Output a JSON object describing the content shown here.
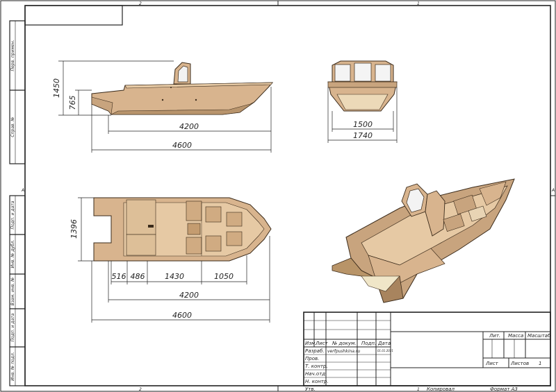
{
  "sheet": {
    "zones": {
      "top_left": "2",
      "top_right": "1",
      "bottom_left": "2",
      "bottom_right": "1",
      "left_mid": "A",
      "right_mid": "A"
    },
    "side_labels": [
      "Перв. примен.",
      "Справ. №",
      "Подп. и дата",
      "Инв. № дубл.",
      "Взам. инв. №",
      "Подп. и дата",
      "Инв. № подл."
    ],
    "footer": {
      "copied": "Копировал",
      "format": "Формат А3"
    }
  },
  "dimensions": {
    "side_height": "1450",
    "side_draft": "765",
    "side_hull_length": "4200",
    "side_total_length": "4600",
    "front_inner_width": "1500",
    "front_outer_width": "1740",
    "plan_width": "1396",
    "plan_seg1": "516",
    "plan_seg2": "486",
    "plan_seg3": "1430",
    "plan_seg4": "1050",
    "plan_hull_length": "4200",
    "plan_total_length": "4600"
  },
  "title_block": {
    "cols": [
      "Изм.",
      "Лист",
      "№ докум.",
      "Подп.",
      "Дата"
    ],
    "rows": [
      "Разраб.",
      "Пров.",
      "Т. контр.",
      "Нач.отд.",
      "Н. контр.",
      "Утв."
    ],
    "developer": "verfpushkina.ru",
    "date": "01.01.2021",
    "lit": "Лит.",
    "mass": "Масса",
    "scale": "Масштаб",
    "sheet": "Лист",
    "sheets": "Листов",
    "sheets_count": "1"
  },
  "colors": {
    "hull": "#d8b48e",
    "hull_dark": "#a8845e",
    "deck": "#e6c9a4",
    "line": "#222222"
  }
}
